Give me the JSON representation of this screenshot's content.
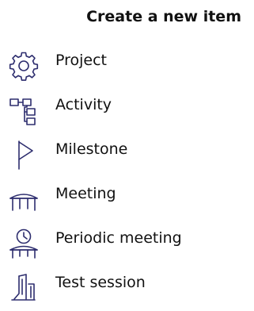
{
  "header": {
    "title": "Create a new item"
  },
  "menu": {
    "items": [
      {
        "label": "Project",
        "icon": "gear-icon"
      },
      {
        "label": "Activity",
        "icon": "hierarchy-icon"
      },
      {
        "label": "Milestone",
        "icon": "flag-icon"
      },
      {
        "label": "Meeting",
        "icon": "table-icon"
      },
      {
        "label": "Periodic meeting",
        "icon": "clock-table-icon"
      },
      {
        "label": "Test session",
        "icon": "test-session-icon"
      }
    ]
  },
  "colors": {
    "icon_stroke": "#2d2d6e",
    "text": "#111111",
    "background": "#ffffff"
  }
}
